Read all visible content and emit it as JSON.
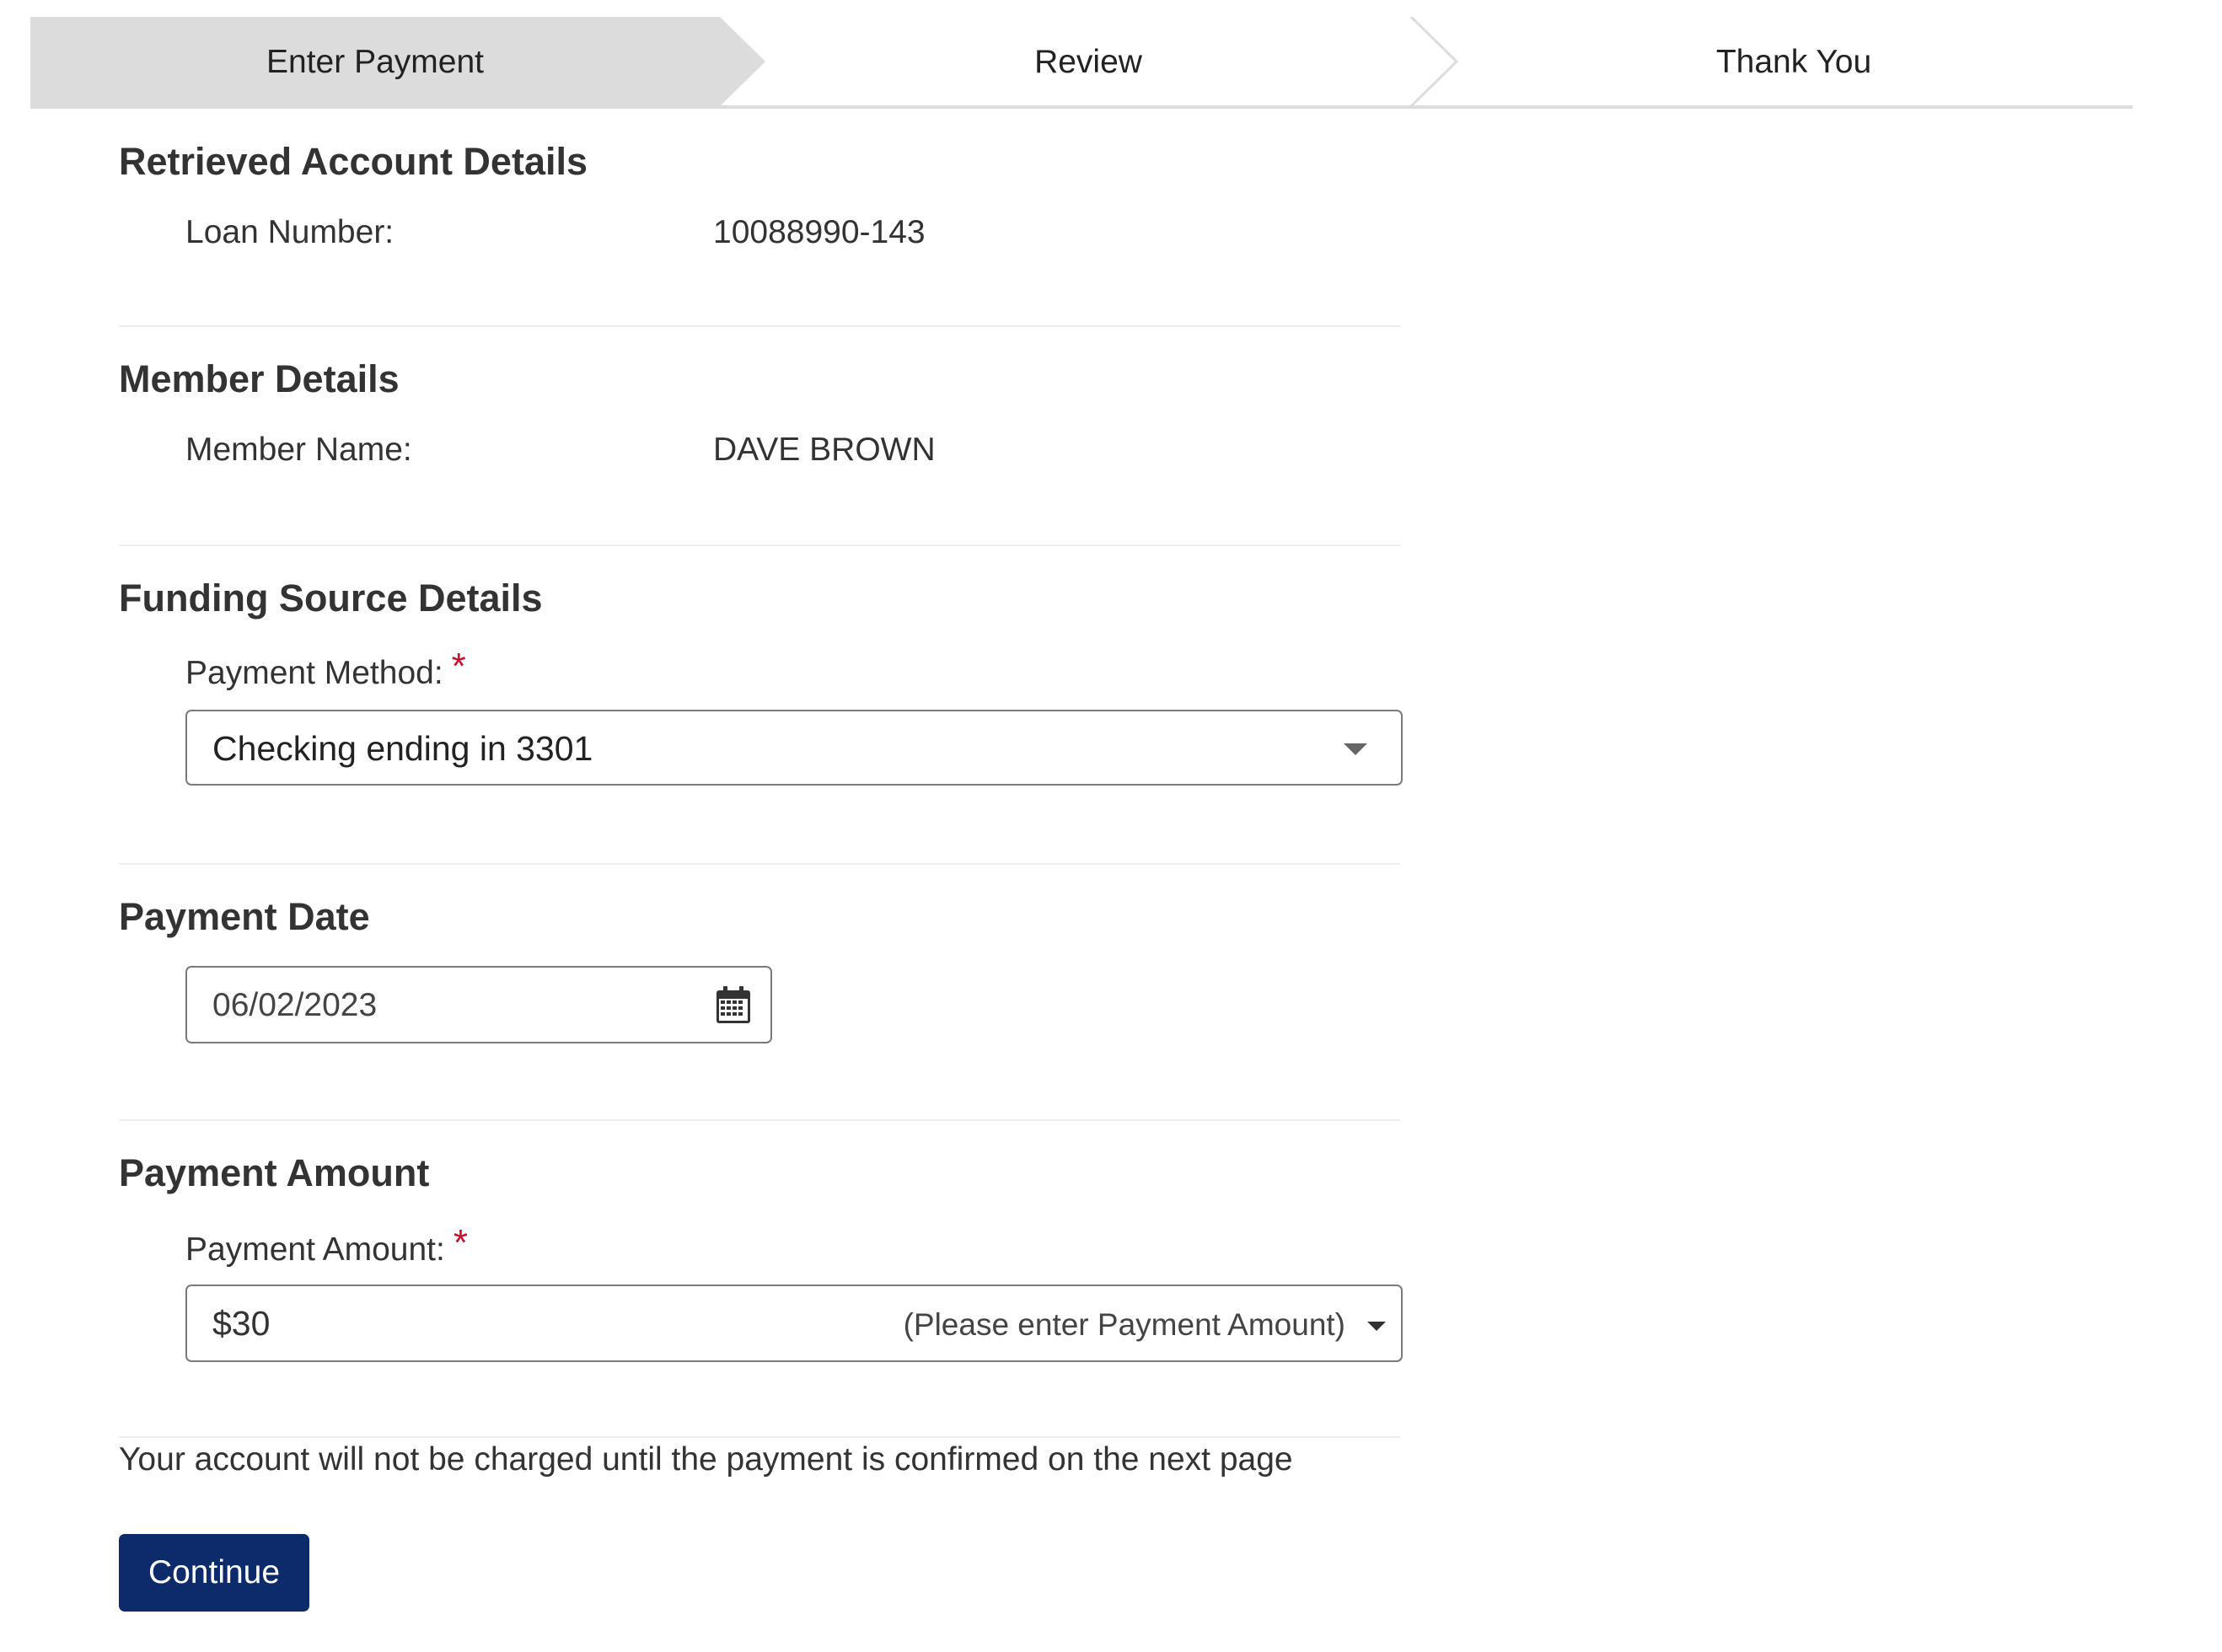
{
  "stepper": {
    "steps": [
      {
        "label": "Enter Payment",
        "active": true
      },
      {
        "label": "Review",
        "active": false
      },
      {
        "label": "Thank You",
        "active": false
      }
    ]
  },
  "account_details": {
    "title": "Retrieved Account Details",
    "loan_number_label": "Loan Number:",
    "loan_number_value": "10088990-143"
  },
  "member_details": {
    "title": "Member Details",
    "member_name_label": "Member Name:",
    "member_name_value": "DAVE BROWN"
  },
  "funding_source": {
    "title": "Funding Source Details",
    "payment_method_label": "Payment Method:",
    "required_mark": "*",
    "payment_method_value": "Checking ending in 3301"
  },
  "payment_date": {
    "title": "Payment Date",
    "date_value": "06/02/2023",
    "icon": "calendar-icon"
  },
  "payment_amount": {
    "title": "Payment Amount",
    "amount_label": "Payment Amount:",
    "required_mark": "*",
    "amount_value": "$30",
    "amount_hint": "(Please enter Payment Amount)"
  },
  "note": "Your account will not be charged until the payment is confirmed on the next page",
  "continue_label": "Continue",
  "colors": {
    "active_step_bg": "#dcdcdc",
    "button_bg": "#0d2a6b",
    "required": "#c8102e",
    "border": "#7a7a7a"
  }
}
